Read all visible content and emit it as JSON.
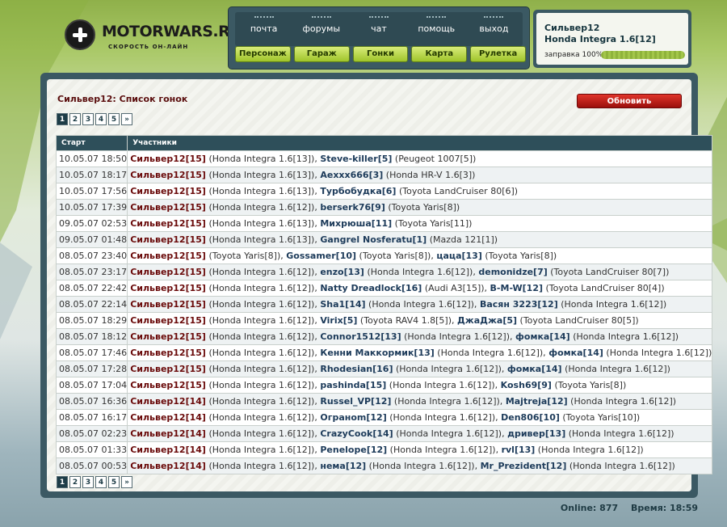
{
  "brand": {
    "name": "MOTORWARS.RU",
    "tagline": "СКОРОСТЬ ОН-ЛАЙН"
  },
  "nav_top": [
    "почта",
    "форумы",
    "чат",
    "помощь",
    "выход"
  ],
  "nav_bottom": [
    "Персонаж",
    "Гараж",
    "Гонки",
    "Карта",
    "Рулетка"
  ],
  "user": {
    "name": "Сильвер12",
    "car": "Honda Integra 1.6[12]",
    "fuel_label": "заправка 100%",
    "fuel_percent": 100
  },
  "page": {
    "title": "Сильвер12: Список гонок",
    "refresh_label": "Обновить"
  },
  "pagination": [
    "1",
    "2",
    "3",
    "4",
    "5",
    "»"
  ],
  "table": {
    "headers": [
      "Старт",
      "Участники"
    ],
    "rows": [
      {
        "date": "10.05.07 18:50",
        "parts": [
          [
            "Сильвер12[15]",
            " (Honda Integra 1.6[13]), "
          ],
          [
            "Steve-killer[5]",
            " (Peugeot 1007[5])"
          ]
        ]
      },
      {
        "date": "10.05.07 18:17",
        "parts": [
          [
            "Сильвер12[15]",
            " (Honda Integra 1.6[13]), "
          ],
          [
            "Aexxx666[3]",
            " (Honda HR-V 1.6[3])"
          ]
        ]
      },
      {
        "date": "10.05.07 17:56",
        "parts": [
          [
            "Сильвер12[15]",
            " (Honda Integra 1.6[13]), "
          ],
          [
            "Турбобудка[6]",
            " (Toyota LandCruiser 80[6])"
          ]
        ]
      },
      {
        "date": "10.05.07 17:39",
        "parts": [
          [
            "Сильвер12[15]",
            " (Honda Integra 1.6[12]), "
          ],
          [
            "berserk76[9]",
            " (Toyota Yaris[8])"
          ]
        ]
      },
      {
        "date": "09.05.07 02:53",
        "parts": [
          [
            "Сильвер12[15]",
            " (Honda Integra 1.6[13]), "
          ],
          [
            "Михрюша[11]",
            " (Toyota Yaris[11])"
          ]
        ]
      },
      {
        "date": "09.05.07 01:48",
        "parts": [
          [
            "Сильвер12[15]",
            " (Honda Integra 1.6[13]), "
          ],
          [
            "Gangrel Nosferatu[1]",
            " (Mazda 121[1])"
          ]
        ]
      },
      {
        "date": "08.05.07 23:40",
        "parts": [
          [
            "Сильвер12[15]",
            " (Toyota Yaris[8]), "
          ],
          [
            "Gossamer[10]",
            " (Toyota Yaris[8]), "
          ],
          [
            "цаца[13]",
            " (Toyota Yaris[8])"
          ]
        ]
      },
      {
        "date": "08.05.07 23:17",
        "parts": [
          [
            "Сильвер12[15]",
            " (Honda Integra 1.6[12]), "
          ],
          [
            "enzo[13]",
            " (Honda Integra 1.6[12]), "
          ],
          [
            "demonidze[7]",
            " (Toyota LandCruiser 80[7])"
          ]
        ]
      },
      {
        "date": "08.05.07 22:42",
        "parts": [
          [
            "Сильвер12[15]",
            " (Honda Integra 1.6[12]), "
          ],
          [
            "Natty Dreadlock[16]",
            " (Audi A3[15]), "
          ],
          [
            "B-M-W[12]",
            " (Toyota LandCruiser 80[4])"
          ]
        ]
      },
      {
        "date": "08.05.07 22:14",
        "parts": [
          [
            "Сильвер12[15]",
            " (Honda Integra 1.6[12]), "
          ],
          [
            "Sha1[14]",
            " (Honda Integra 1.6[12]), "
          ],
          [
            "Васян 3223[12]",
            " (Honda Integra 1.6[12])"
          ]
        ]
      },
      {
        "date": "08.05.07 18:29",
        "parts": [
          [
            "Сильвер12[15]",
            " (Honda Integra 1.6[12]), "
          ],
          [
            "Virix[5]",
            " (Toyota RAV4 1.8[5]), "
          ],
          [
            "ДжаДжа[5]",
            " (Toyota LandCruiser 80[5])"
          ]
        ]
      },
      {
        "date": "08.05.07 18:12",
        "parts": [
          [
            "Сильвер12[15]",
            " (Honda Integra 1.6[12]), "
          ],
          [
            "Connor1512[13]",
            " (Honda Integra 1.6[12]), "
          ],
          [
            "фомка[14]",
            " (Honda Integra 1.6[12])"
          ]
        ]
      },
      {
        "date": "08.05.07 17:46",
        "parts": [
          [
            "Сильвер12[15]",
            " (Honda Integra 1.6[12]), "
          ],
          [
            "Кенни Маккормик[13]",
            " (Honda Integra 1.6[12]), "
          ],
          [
            "фомка[14]",
            " (Honda Integra 1.6[12])"
          ]
        ]
      },
      {
        "date": "08.05.07 17:28",
        "parts": [
          [
            "Сильвер12[15]",
            " (Honda Integra 1.6[12]), "
          ],
          [
            "Rhodesian[16]",
            " (Honda Integra 1.6[12]), "
          ],
          [
            "фомка[14]",
            " (Honda Integra 1.6[12])"
          ]
        ]
      },
      {
        "date": "08.05.07 17:04",
        "parts": [
          [
            "Сильвер12[15]",
            " (Honda Integra 1.6[12]), "
          ],
          [
            "pashinda[15]",
            " (Honda Integra 1.6[12]), "
          ],
          [
            "Kosh69[9]",
            " (Toyota Yaris[8])"
          ]
        ]
      },
      {
        "date": "08.05.07 16:36",
        "parts": [
          [
            "Сильвер12[14]",
            " (Honda Integra 1.6[12]), "
          ],
          [
            "Russel_VP[12]",
            " (Honda Integra 1.6[12]), "
          ],
          [
            "Majtreja[12]",
            " (Honda Integra 1.6[12])"
          ]
        ]
      },
      {
        "date": "08.05.07 16:17",
        "parts": [
          [
            "Сильвер12[14]",
            " (Honda Integra 1.6[12]), "
          ],
          [
            "Огранom[12]",
            " (Honda Integra 1.6[12]), "
          ],
          [
            "Den806[10]",
            " (Toyota Yaris[10])"
          ]
        ]
      },
      {
        "date": "08.05.07 02:23",
        "parts": [
          [
            "Сильвер12[14]",
            " (Honda Integra 1.6[12]), "
          ],
          [
            "CrazyCook[14]",
            " (Honda Integra 1.6[12]), "
          ],
          [
            "дривер[13]",
            " (Honda Integra 1.6[12])"
          ]
        ]
      },
      {
        "date": "08.05.07 01:33",
        "parts": [
          [
            "Сильвер12[14]",
            " (Honda Integra 1.6[12]), "
          ],
          [
            "Penelope[12]",
            " (Honda Integra 1.6[12]), "
          ],
          [
            "rvl[13]",
            " (Honda Integra 1.6[12])"
          ]
        ]
      },
      {
        "date": "08.05.07 00:53",
        "parts": [
          [
            "Сильвер12[14]",
            " (Honda Integra 1.6[12]), "
          ],
          [
            "нема[12]",
            " (Honda Integra 1.6[12]), "
          ],
          [
            "Mr_Prezident[12]",
            " (Honda Integra 1.6[12])"
          ]
        ]
      }
    ]
  },
  "footer": {
    "online": "Online: 877",
    "time": "Время: 18:59"
  }
}
